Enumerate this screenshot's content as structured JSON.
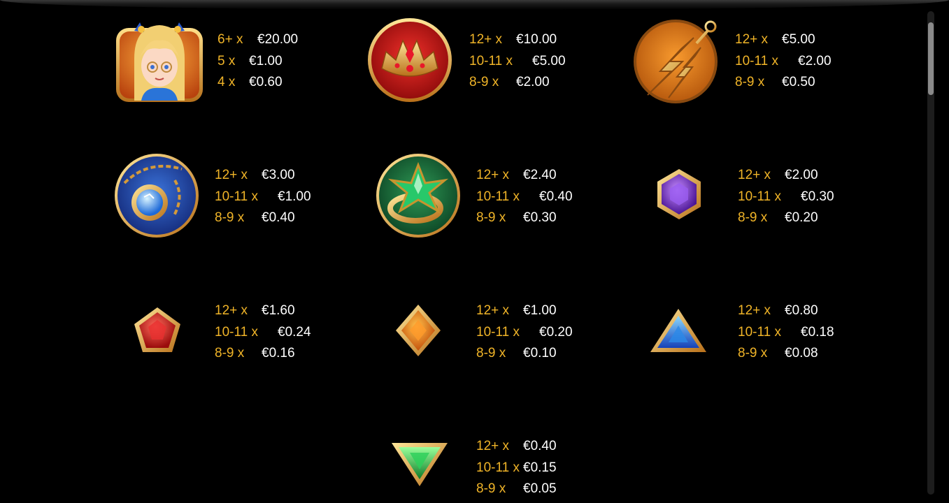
{
  "colors": {
    "background": "#000000",
    "count": "#f0b428",
    "value": "#ffffff"
  },
  "paytable": [
    {
      "symbol": "anime-heroine-icon",
      "lines": [
        {
          "count": "6+ x",
          "value": "€20.00"
        },
        {
          "count": "5 x",
          "value": "€1.00"
        },
        {
          "count": "4 x",
          "value": "€0.60"
        }
      ]
    },
    {
      "symbol": "tiara-icon",
      "lines": [
        {
          "count": "12+ x",
          "value": "€10.00"
        },
        {
          "count": "10-11 x",
          "value": "€5.00"
        },
        {
          "count": "8-9 x",
          "value": "€2.00"
        }
      ]
    },
    {
      "symbol": "lightning-earring-icon",
      "lines": [
        {
          "count": "12+ x",
          "value": "€5.00"
        },
        {
          "count": "10-11 x",
          "value": "€2.00"
        },
        {
          "count": "8-9 x",
          "value": "€0.50"
        }
      ]
    },
    {
      "symbol": "pendant-necklace-icon",
      "lines": [
        {
          "count": "12+ x",
          "value": "€3.00"
        },
        {
          "count": "10-11 x",
          "value": "€1.00"
        },
        {
          "count": "8-9 x",
          "value": "€0.40"
        }
      ]
    },
    {
      "symbol": "emerald-ring-icon",
      "lines": [
        {
          "count": "12+ x",
          "value": "€2.40"
        },
        {
          "count": "10-11 x",
          "value": "€0.40"
        },
        {
          "count": "8-9 x",
          "value": "€0.30"
        }
      ]
    },
    {
      "symbol": "purple-hexagon-gem-icon",
      "lines": [
        {
          "count": "12+ x",
          "value": "€2.00"
        },
        {
          "count": "10-11 x",
          "value": "€0.30"
        },
        {
          "count": "8-9 x",
          "value": "€0.20"
        }
      ]
    },
    {
      "symbol": "red-pentagon-gem-icon",
      "lines": [
        {
          "count": "12+ x",
          "value": "€1.60"
        },
        {
          "count": "10-11 x",
          "value": "€0.24"
        },
        {
          "count": "8-9 x",
          "value": "€0.16"
        }
      ]
    },
    {
      "symbol": "orange-diamond-gem-icon",
      "lines": [
        {
          "count": "12+ x",
          "value": "€1.00"
        },
        {
          "count": "10-11 x",
          "value": "€0.20"
        },
        {
          "count": "8-9 x",
          "value": "€0.10"
        }
      ]
    },
    {
      "symbol": "blue-triangle-gem-icon",
      "lines": [
        {
          "count": "12+ x",
          "value": "€0.80"
        },
        {
          "count": "10-11 x",
          "value": "€0.18"
        },
        {
          "count": "8-9 x",
          "value": "€0.08"
        }
      ]
    },
    {
      "symbol": "green-triangle-gem-icon",
      "lines": [
        {
          "count": "12+ x",
          "value": "€0.40"
        },
        {
          "count": "10-11 x",
          "value": "€0.15"
        },
        {
          "count": "8-9 x",
          "value": "€0.05"
        }
      ]
    }
  ]
}
